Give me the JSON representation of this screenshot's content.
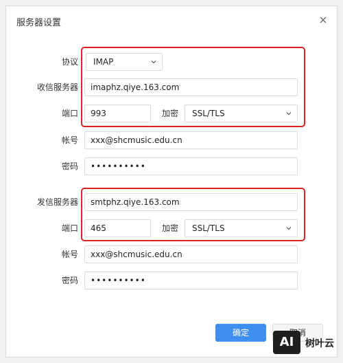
{
  "dialog": {
    "title": "服务器设置"
  },
  "incoming": {
    "protocol_label": "协议",
    "protocol_value": "IMAP",
    "server_label": "收信服务器",
    "server_value": "imaphz.qiye.163.com",
    "port_label": "端口",
    "port_value": "993",
    "encryption_label": "加密",
    "encryption_value": "SSL/TLS",
    "account_label": "帐号",
    "account_value": "xxx@shcmusic.edu.cn",
    "password_label": "密码",
    "password_value": "••••••••••"
  },
  "outgoing": {
    "server_label": "发信服务器",
    "server_value": "smtphz.qiye.163.com",
    "port_label": "端口",
    "port_value": "465",
    "encryption_label": "加密",
    "encryption_value": "SSL/TLS",
    "account_label": "帐号",
    "account_value": "xxx@shcmusic.edu.cn",
    "password_label": "密码",
    "password_value": "••••••••••"
  },
  "buttons": {
    "ok_label": "确定",
    "cancel_label": "取消"
  },
  "watermark": {
    "logo_text": "AI",
    "brand_text": "树叶云"
  },
  "colors": {
    "primary": "#3f8ff0",
    "highlight": "#e02020"
  },
  "icons": {
    "close": "close-icon",
    "dropdown": "chevron-down-icon"
  }
}
